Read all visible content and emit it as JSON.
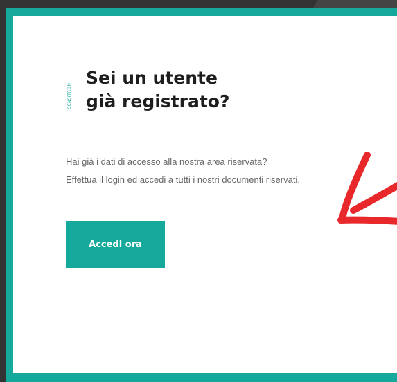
{
  "login_card": {
    "brand_text": "SENSITRON",
    "heading_line1": "Sei un utente",
    "heading_line2": "già registrato?",
    "description_line1": "Hai già i dati di accesso alla nostra area riservata?",
    "description_line2": "Effettua il login ed accedi a tutti i nostri documenti riservati.",
    "button_label": "Accedi ora"
  },
  "annotation": {
    "icon": "red-arrow-icon",
    "color": "#e8282b"
  },
  "colors": {
    "accent": "#14a99a",
    "background": "#333333",
    "heading": "#1e1e1e",
    "text": "#666666"
  }
}
